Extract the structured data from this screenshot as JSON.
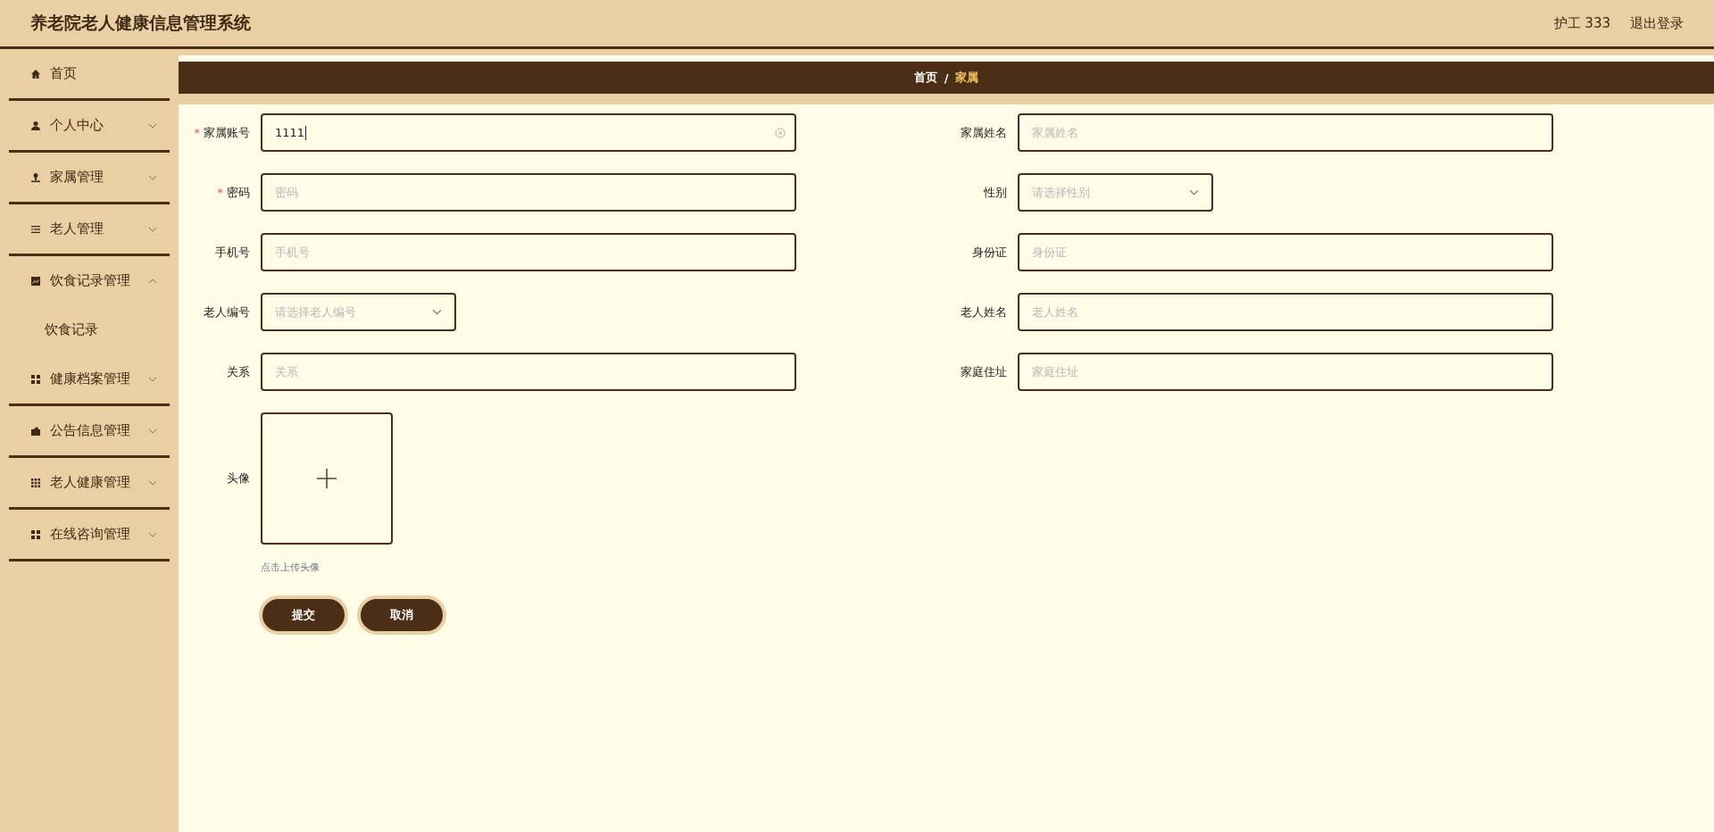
{
  "header": {
    "title": "养老院老人健康信息管理系统",
    "user": "护工 333",
    "logout": "退出登录"
  },
  "sidebar": {
    "items": [
      {
        "label": "首页",
        "has_arrow": false,
        "expanded": false
      },
      {
        "label": "个人中心",
        "has_arrow": true,
        "expanded": false
      },
      {
        "label": "家属管理",
        "has_arrow": true,
        "expanded": false
      },
      {
        "label": "老人管理",
        "has_arrow": true,
        "expanded": false
      },
      {
        "label": "饮食记录管理",
        "has_arrow": true,
        "expanded": true,
        "children": [
          {
            "label": "饮食记录"
          }
        ]
      },
      {
        "label": "健康档案管理",
        "has_arrow": true,
        "expanded": false
      },
      {
        "label": "公告信息管理",
        "has_arrow": true,
        "expanded": false
      },
      {
        "label": "老人健康管理",
        "has_arrow": true,
        "expanded": false
      },
      {
        "label": "在线咨询管理",
        "has_arrow": true,
        "expanded": false
      }
    ]
  },
  "breadcrumb": {
    "separator": "/",
    "items": [
      {
        "label": "首页",
        "current": false
      },
      {
        "label": "家属",
        "current": true
      }
    ]
  },
  "form": {
    "required_mark": "*",
    "rows": [
      [
        {
          "label": "家属账号",
          "required": true,
          "kind": "input",
          "value": "1111",
          "clearable": true
        },
        {
          "label": "家属姓名",
          "required": false,
          "kind": "input",
          "placeholder": "家属姓名",
          "clearable": false
        }
      ],
      [
        {
          "label": "密码",
          "required": true,
          "kind": "input",
          "placeholder": "密码",
          "clearable": false
        },
        {
          "label": "性别",
          "required": false,
          "kind": "select",
          "placeholder": "请选择性别"
        }
      ],
      [
        {
          "label": "手机号",
          "required": false,
          "kind": "input",
          "placeholder": "手机号",
          "clearable": false
        },
        {
          "label": "身份证",
          "required": false,
          "kind": "input",
          "placeholder": "身份证",
          "clearable": false
        }
      ],
      [
        {
          "label": "老人编号",
          "required": false,
          "kind": "select",
          "placeholder": "请选择老人编号"
        },
        {
          "label": "老人姓名",
          "required": false,
          "kind": "input",
          "placeholder": "老人姓名",
          "clearable": false
        }
      ],
      [
        {
          "label": "关系",
          "required": false,
          "kind": "input",
          "placeholder": "关系",
          "clearable": false
        },
        {
          "label": "家庭住址",
          "required": false,
          "kind": "input",
          "placeholder": "家庭住址",
          "clearable": false
        }
      ],
      [
        {
          "label": "头像",
          "required": false,
          "kind": "upload",
          "hint": "点击上传头像"
        }
      ]
    ],
    "buttons": [
      "提交",
      "取消"
    ]
  }
}
